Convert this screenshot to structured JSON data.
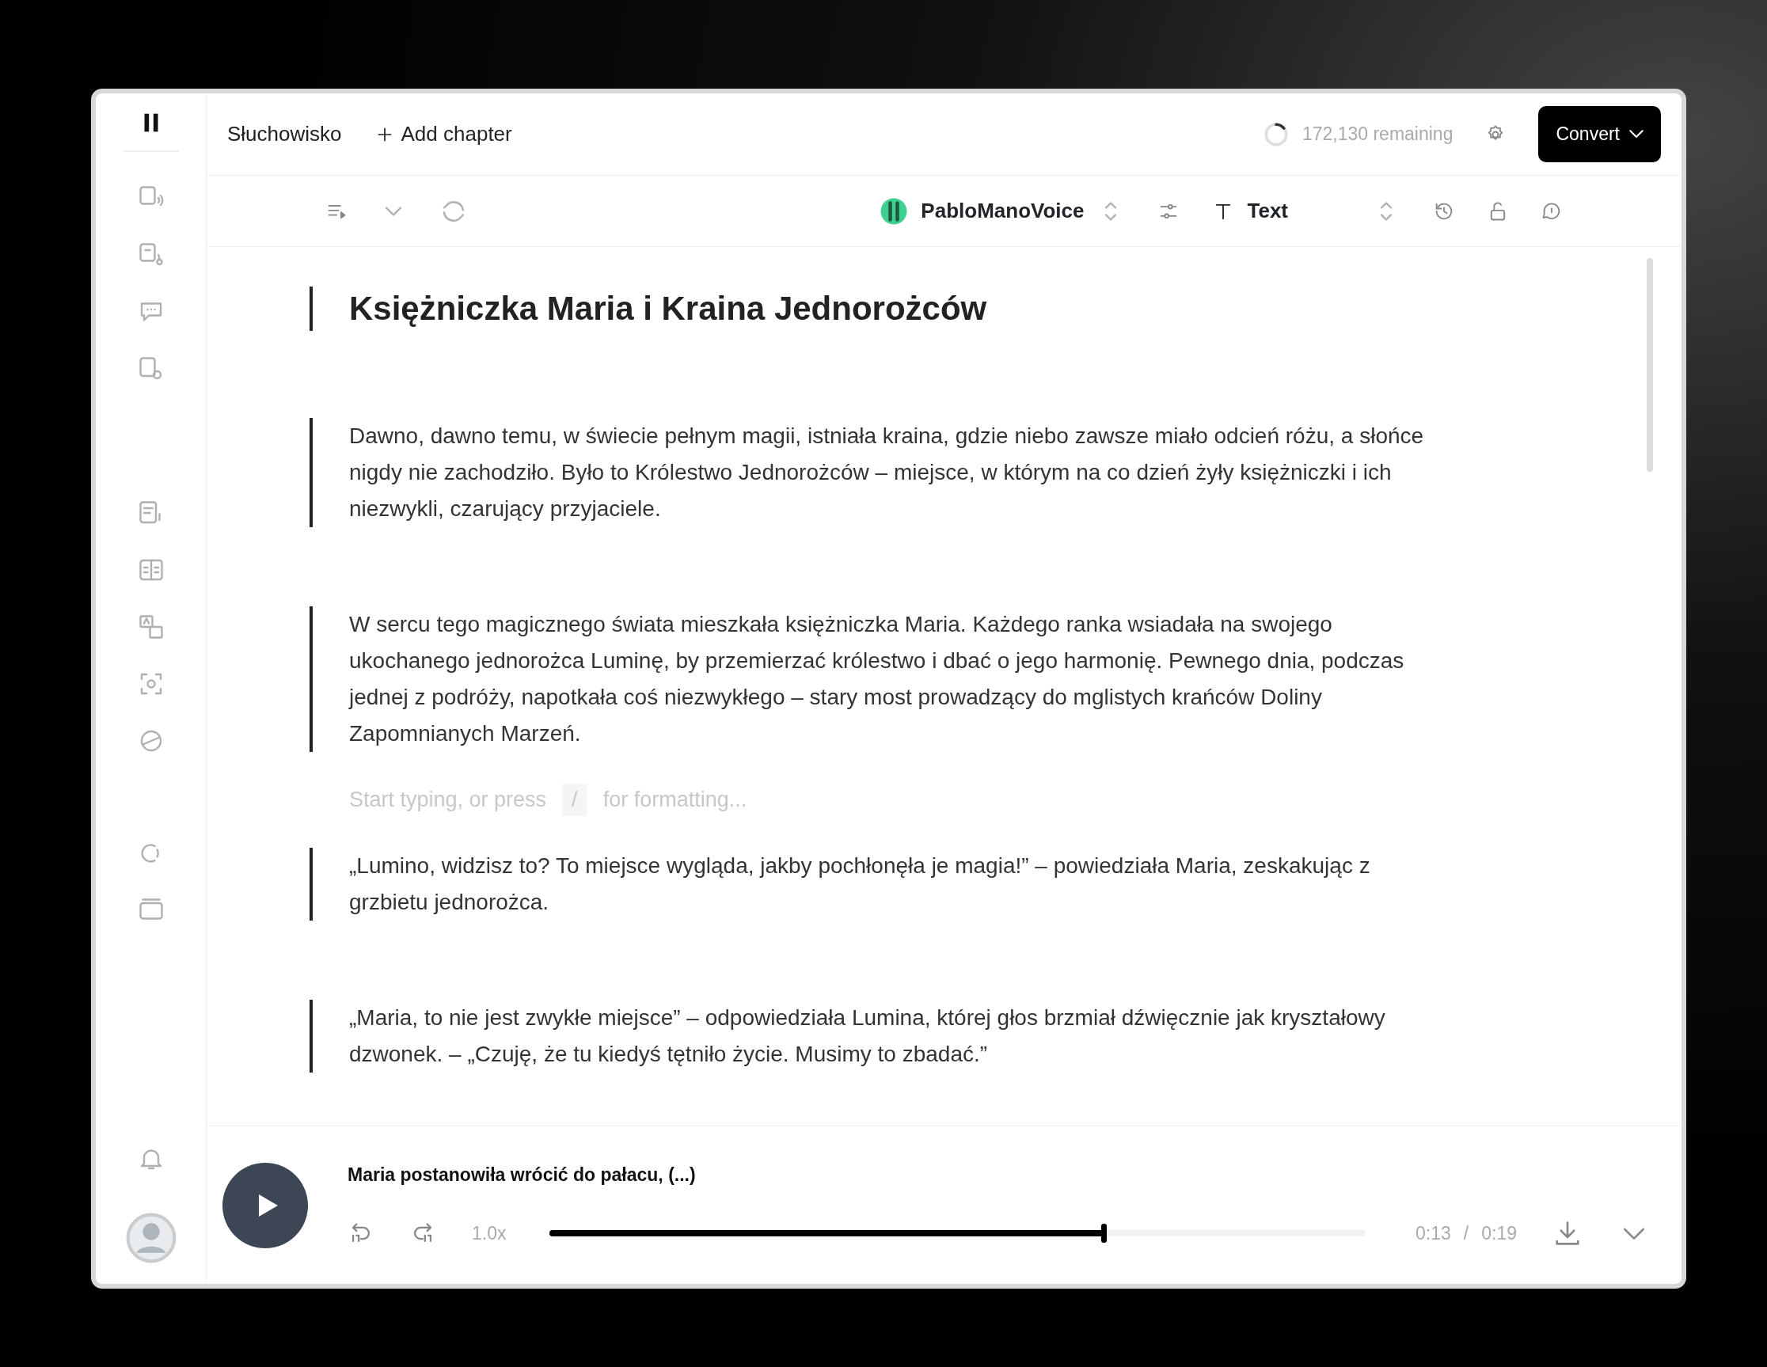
{
  "topbar": {
    "project": "Słuchowisko",
    "add_chapter": "Add chapter",
    "remaining": "172,130 remaining",
    "convert": "Convert"
  },
  "toolbar": {
    "voice": "PabloManoVoice",
    "mode": "Text"
  },
  "document": {
    "blocks": [
      {
        "kind": "heading",
        "text": "Księżniczka Maria i Kraina Jednorożców"
      },
      {
        "kind": "paragraph",
        "text": "Dawno, dawno temu, w świecie pełnym magii, istniała kraina, gdzie niebo zawsze miało odcień różu, a słońce nigdy nie zachodziło. Było to Królestwo Jednorożców – miejsce, w którym na co dzień żyły księżniczki i ich niezwykli, czarujący przyjaciele."
      },
      {
        "kind": "paragraph",
        "text": "W sercu tego magicznego świata mieszkała księżniczka Maria. Każdego ranka wsiadała na swojego ukochanego jednorożca Luminę, by przemierzać królestwo i dbać o jego harmonię. Pewnego dnia, podczas jednej z podróży, napotkała coś niezwykłego – stary most prowadzący do mglistych krańców Doliny Zapomnianych Marzeń."
      },
      {
        "kind": "placeholder",
        "text": "Start typing, or press",
        "key": "/",
        "rest": "for formatting..."
      },
      {
        "kind": "paragraph",
        "text": "„Lumino, widzisz to? To miejsce wygląda, jakby pochłonęła je magia!” – powiedziała Maria, zeskakując z grzbietu jednorożca."
      },
      {
        "kind": "paragraph",
        "text": "„Maria, to nie jest zwykłe miejsce” – odpowiedziała Lumina, której głos brzmiał dźwięcznie jak kryształowy dzwonek. – „Czuję, że tu kiedyś tętniło życie. Musimy to zbadać.”"
      }
    ]
  },
  "player": {
    "title": "Maria postanowiła wrócić do pałacu, (...)",
    "speed": "1.0x",
    "level": 0.68,
    "elapsed": "0:13",
    "separator": "/",
    "duration": "0:19"
  }
}
